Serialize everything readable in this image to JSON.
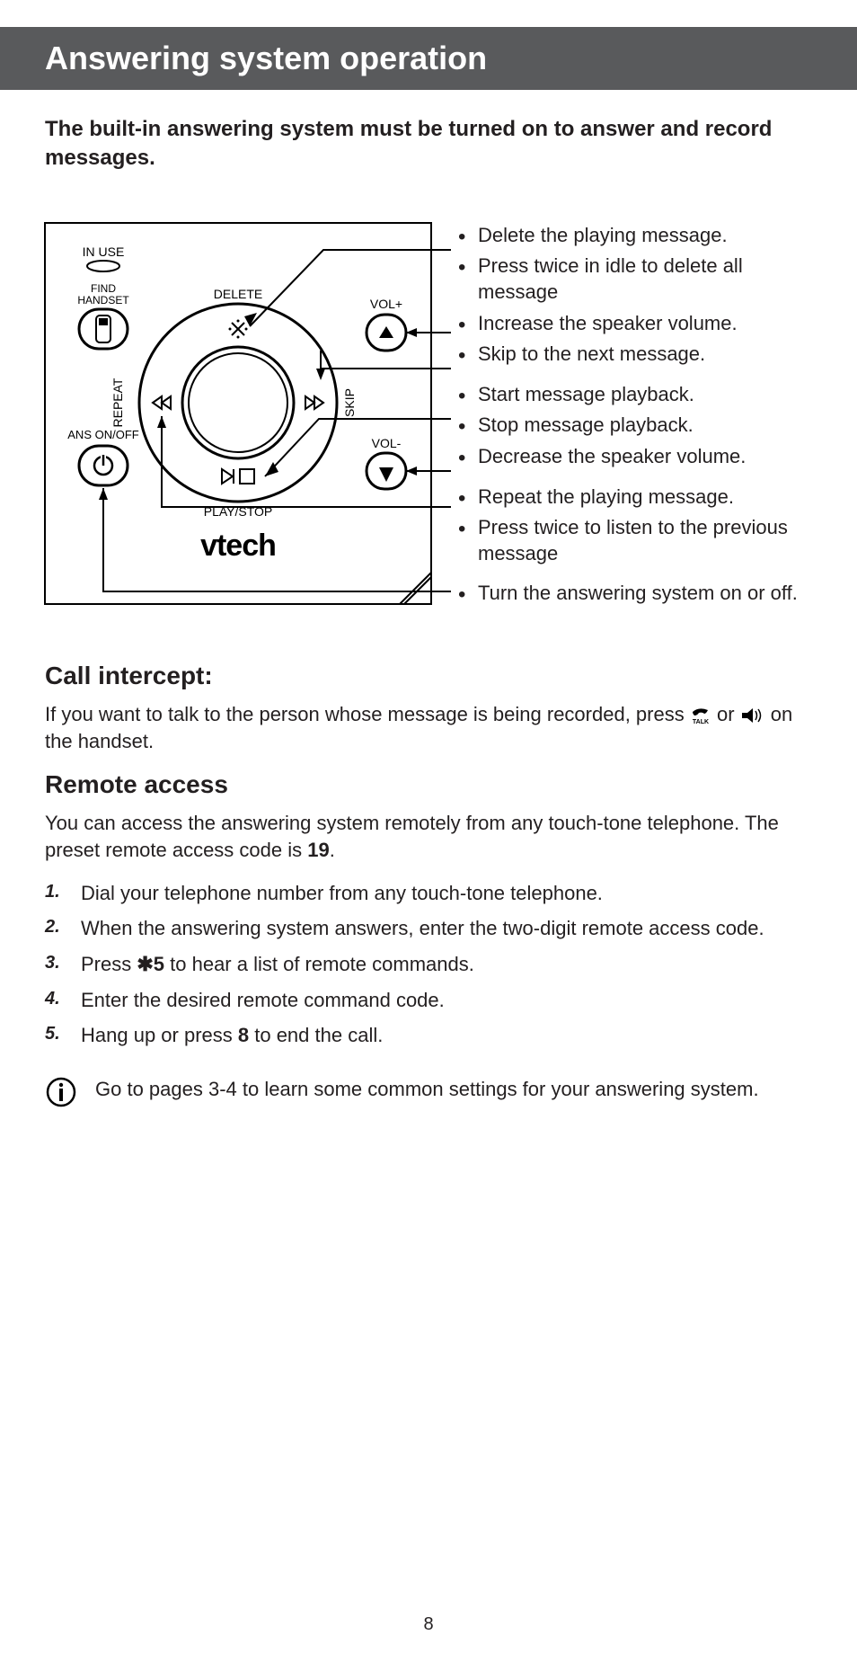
{
  "header": "Answering system operation",
  "lead": "The built-in answering system must be turned on to answer and record messages.",
  "diagram": {
    "labels": {
      "in_use": "IN USE",
      "find_handset": "FIND\nHANDSET",
      "delete": "DELETE",
      "vol_plus": "VOL+",
      "vol_minus": "VOL-",
      "repeat": "REPEAT",
      "skip": "SKIP",
      "ans_onoff": "ANS ON/OFF",
      "play_stop": "PLAY/STOP",
      "brand": "vtech"
    }
  },
  "annotations": {
    "delete_1": "Delete the playing message.",
    "delete_2": "Press twice in idle to delete all message",
    "vol_up": "Increase the speaker volume.",
    "skip": "Skip to the next message.",
    "play_1": "Start message playback.",
    "play_2": "Stop message playback.",
    "vol_down": "Decrease the speaker volume.",
    "repeat_1": "Repeat the playing message.",
    "repeat_2": "Press twice to listen to the previous message",
    "ans": "Turn the answering system on or off."
  },
  "call_intercept": {
    "heading": "Call intercept:",
    "text_1": "If you want to talk to the person whose message is being recorded, press ",
    "text_2": " or ",
    "text_3": " on the handset."
  },
  "remote_access": {
    "heading": "Remote access",
    "intro_1": "You can access the answering system remotely from any touch-tone telephone. The preset remote access code is ",
    "intro_code": "19",
    "intro_2": ".",
    "steps": {
      "s1": "Dial your telephone number from any touch-tone telephone.",
      "s2": "When the answering system answers, enter the two-digit remote access code.",
      "s3_a": "Press ",
      "s3_key": "✱5",
      "s3_b": " to hear a list of remote commands.",
      "s4": "Enter the desired remote command code.",
      "s5_a": "Hang up or press ",
      "s5_key": "8",
      "s5_b": " to end the call."
    }
  },
  "info_tip": "Go to pages 3-4 to learn some common settings for your answering system.",
  "page_number": "8"
}
